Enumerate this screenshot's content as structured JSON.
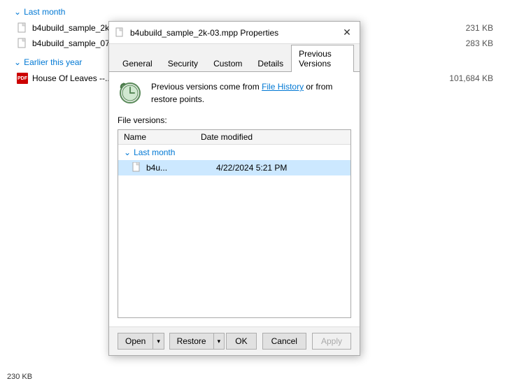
{
  "background": {
    "section1_label": "Last month",
    "file1_name": "b4ubuild_sample_2k...",
    "file1_size": "231 KB",
    "file2_name": "b4ubuild_sample_07...",
    "file2_size": "283 KB",
    "section2_label": "Earlier this year",
    "file3_name": "House Of Leaves --...",
    "file3_size": "101,684 KB",
    "bottom_size": "230 KB"
  },
  "dialog": {
    "title": "b4ubuild_sample_2k-03.mpp Properties",
    "tabs": [
      {
        "label": "General",
        "active": false
      },
      {
        "label": "Security",
        "active": false
      },
      {
        "label": "Custom",
        "active": false
      },
      {
        "label": "Details",
        "active": false
      },
      {
        "label": "Previous Versions",
        "active": true
      }
    ],
    "info_text_line1": "Previous versions come from ",
    "info_link_text": "File History",
    "info_text_line2": " or from",
    "info_text_line3": "restore points.",
    "file_versions_label": "File versions:",
    "columns": {
      "name": "Name",
      "date_modified": "Date modified"
    },
    "section_label": "Last month",
    "file_entry": {
      "name": "b4u...",
      "date": "4/22/2024 5:21 PM"
    },
    "buttons": {
      "open": "Open",
      "restore": "Restore",
      "ok": "OK",
      "cancel": "Cancel",
      "apply": "Apply"
    }
  }
}
